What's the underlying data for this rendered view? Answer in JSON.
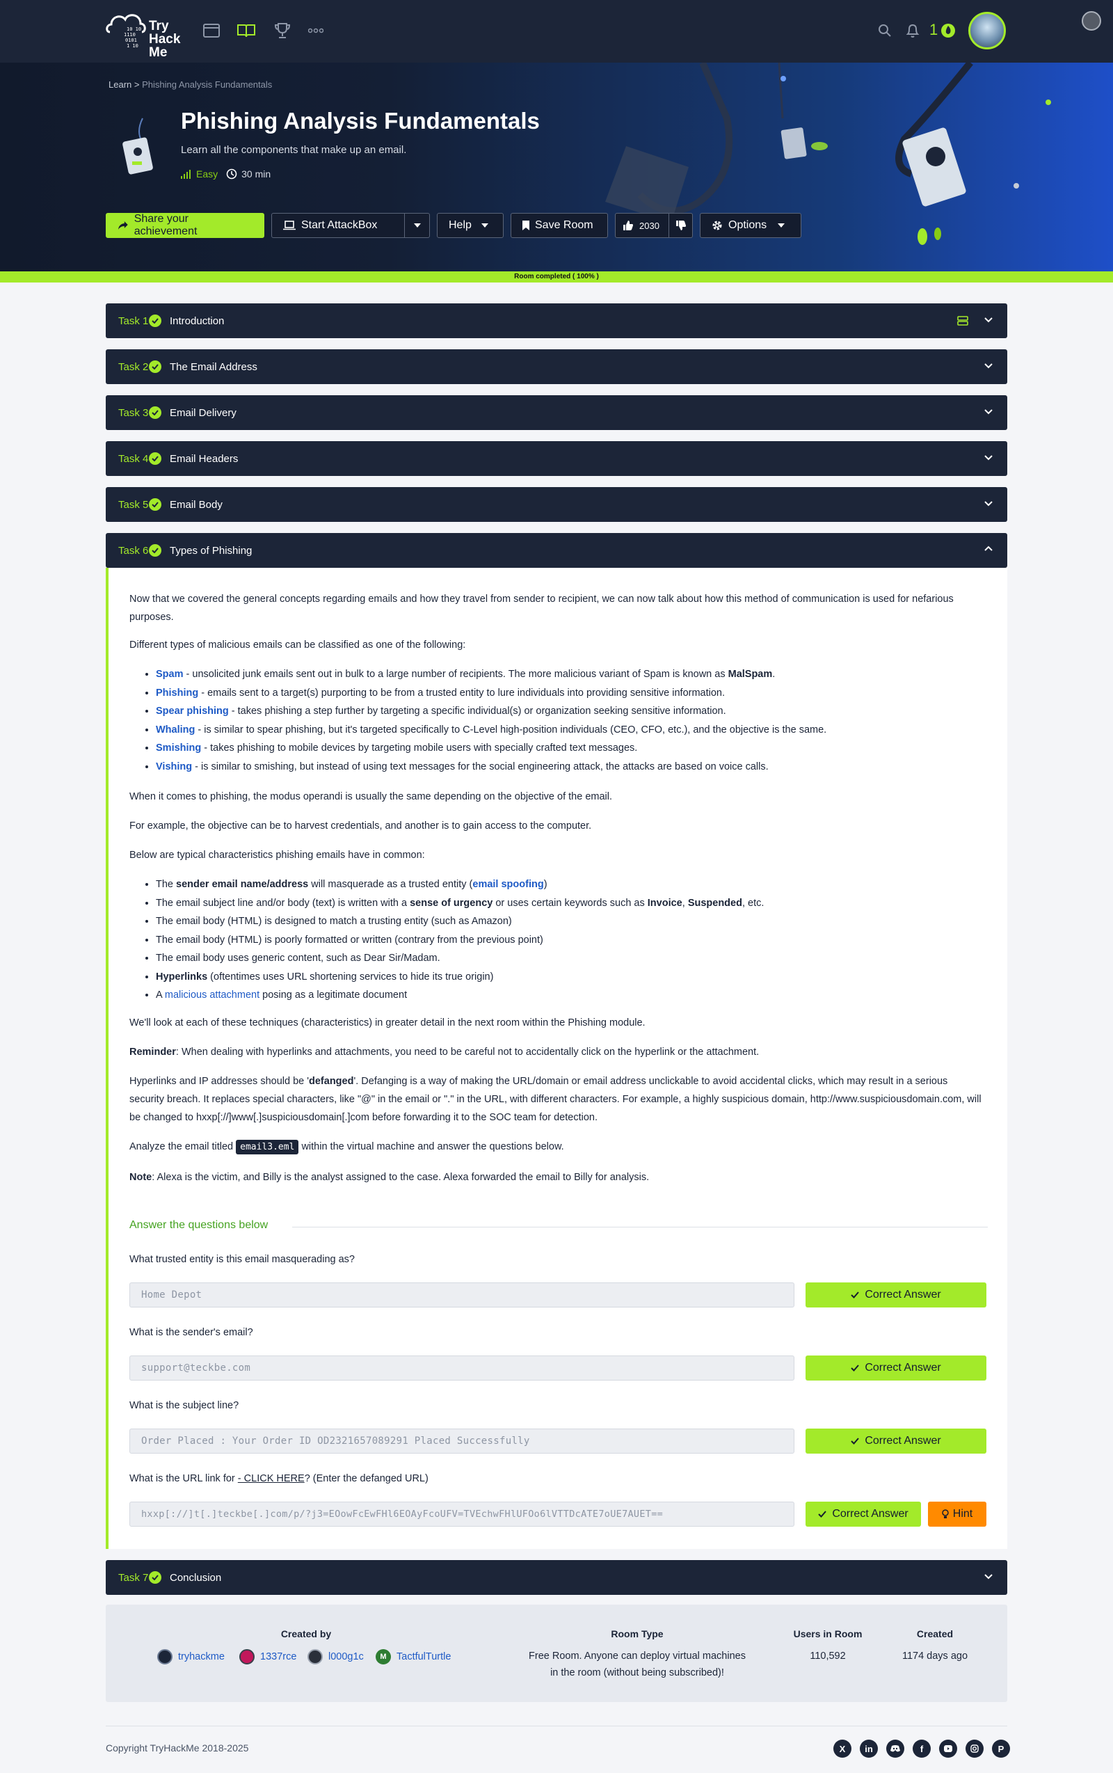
{
  "nav": {
    "logo_text": "Try Hack Me",
    "streak": "1"
  },
  "breadcrumb": {
    "root": "Learn",
    "sep": ">",
    "current": "Phishing Analysis Fundamentals"
  },
  "room": {
    "title": "Phishing Analysis Fundamentals",
    "description": "Learn all the components that make up an email.",
    "difficulty": "Easy",
    "duration": "30 min"
  },
  "toolbar": {
    "share": "Share your achievement",
    "attackbox": "Start AttackBox",
    "help": "Help",
    "save": "Save Room",
    "likes": "2030",
    "options": "Options"
  },
  "progress": {
    "label": "Room completed ( 100% )",
    "value": 100
  },
  "tasks": [
    {
      "num": "Task 1",
      "title": "Introduction"
    },
    {
      "num": "Task 2",
      "title": "The Email Address"
    },
    {
      "num": "Task 3",
      "title": "Email Delivery"
    },
    {
      "num": "Task 4",
      "title": "Email Headers"
    },
    {
      "num": "Task 5",
      "title": "Email Body"
    },
    {
      "num": "Task 6",
      "title": "Types of Phishing"
    },
    {
      "num": "Task 7",
      "title": "Conclusion"
    }
  ],
  "body": {
    "p1": "Now that we covered the general concepts regarding emails and how they travel from sender to recipient, we can now talk about how this method of communication is used for nefarious purposes.",
    "p2": "Different types of malicious emails can be classified as one of the following:",
    "types": [
      {
        "term": "Spam",
        "text": " - unsolicited junk emails sent out in bulk to a large number of recipients. The more malicious variant of Spam is known as ",
        "extra": "MalSpam",
        "end": "."
      },
      {
        "term": "Phishing",
        "text": " -  emails sent to a target(s) purporting to be from a trusted entity to lure individuals into providing sensitive information.",
        "extra": "",
        "end": ""
      },
      {
        "term": "Spear phishing",
        "text": " - takes phishing a step further by targeting a specific individual(s) or organization seeking sensitive information.",
        "extra": "",
        "end": ""
      },
      {
        "term": "Whaling",
        "text": " - is similar to spear phishing, but it's targeted specifically to C-Level high-position individuals (CEO, CFO, etc.), and the objective is the same.",
        "extra": "",
        "end": ""
      },
      {
        "term": "Smishing",
        "text": " - takes phishing to mobile devices by targeting mobile users with specially crafted text messages.",
        "extra": "",
        "end": ""
      },
      {
        "term": "Vishing",
        "text": " - is similar to smishing, but instead of using text messages for the social engineering attack, the attacks are based on voice calls.",
        "extra": "",
        "end": ""
      }
    ],
    "p3": "When it comes to phishing, the modus operandi is usually the same depending on the objective of the email.",
    "p4": "For example, the objective can be to harvest credentials, and another is to gain access to the computer.",
    "p5": "Below are typical characteristics phishing emails have in common:",
    "c1a": "The ",
    "c1b": "sender email name/address",
    "c1c": " will masquerade as a trusted entity (",
    "c1d": "email spoofing",
    "c1e": ")",
    "c2a": "The email subject line and/or body (text) is written with a ",
    "c2b": "sense of urgency",
    "c2c": " or uses certain keywords such as ",
    "c2d": "Invoice",
    "c2e": ", ",
    "c2f": "Suspended",
    "c2g": ", etc.",
    "c3": "The email body (HTML) is designed to match a trusting entity (such as Amazon)",
    "c4": "The email body (HTML) is poorly formatted or written (contrary from the previous point)",
    "c5": "The email body uses generic content, such as Dear Sir/Madam.",
    "c6a": "Hyperlinks",
    "c6b": " (oftentimes uses URL shortening services to hide its true origin)",
    "c7a": "A ",
    "c7b": "malicious attachment",
    "c7c": " posing as a legitimate document",
    "p6": "We'll look at each of these techniques (characteristics) in greater detail in the next room within the Phishing module.",
    "p7a": "Reminder",
    "p7b": ": When dealing with hyperlinks and attachments, you need to be careful not to accidentally click on the hyperlink or the attachment.",
    "p8a": "Hyperlinks and IP addresses should be '",
    "p8b": "defanged",
    "p8c": "'. Defanging is a way of making the URL/domain or email address unclickable to avoid accidental clicks, which may result in a serious security breach. It replaces special characters, like \"@\" in the email or \".\" in the URL, with different characters. For example, a highly suspicious domain, http://www.suspiciousdomain.com, will be changed to hxxp[://]www[.]suspiciousdomain[.]com before forwarding it to the SOC team for detection.",
    "p9a": "Analyze the email titled ",
    "p9b": "email3.eml",
    "p9c": " within the virtual machine and answer the questions below.",
    "p10a": "Note",
    "p10b": ": Alexa is the victim, and Billy is the analyst assigned to the case. Alexa forwarded the email to Billy for analysis."
  },
  "questions": {
    "heading": "Answer the questions below",
    "correct_label": "Correct Answer",
    "hint_label": "Hint",
    "items": [
      {
        "q": "What trusted entity is this email masquerading as?",
        "a": "Home Depot"
      },
      {
        "q": "What is the sender's email?",
        "a": "support@teckbe.com"
      },
      {
        "q": "What is the subject line?",
        "a": "Order Placed : Your Order ID OD2321657089291 Placed Successfully"
      },
      {
        "q_a": "What is the URL link for ",
        "q_b": "- CLICK HERE",
        "q_c": "? (Enter the defanged URL)",
        "a": "hxxp[://]t[.]teckbe[.]com/p/?j3=EOowFcEwFHl6EOAyFcoUFV=TVEchwFHlUFOo6lVTTDcATE7oUE7AUET=="
      }
    ]
  },
  "info": {
    "created_by_label": "Created by",
    "creators": [
      "tryhackme",
      "1337rce",
      "l000g1c",
      "TactfulTurtle"
    ],
    "room_type_label": "Room Type",
    "room_type_1": "Free Room. Anyone can deploy virtual machines",
    "room_type_2": "in the room (without being subscribed)!",
    "users_label": "Users in Room",
    "users": "110,592",
    "created_label": "Created",
    "created": "1174 days ago"
  },
  "footer": {
    "copyright": "Copyright TryHackMe 2018-2025"
  },
  "colors": {
    "navy": "#1c2538",
    "accent": "#a3ea2a",
    "link": "#1f5bc6",
    "hint": "#ff8a00"
  }
}
